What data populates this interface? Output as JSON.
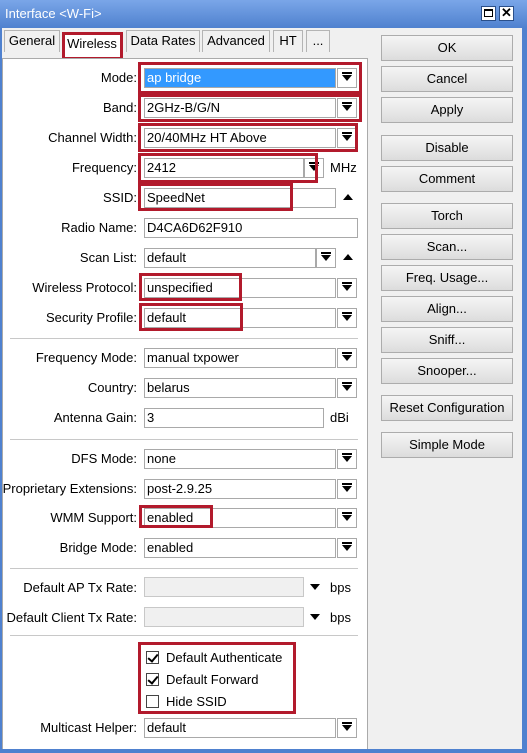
{
  "window": {
    "title": "Interface <W-Fi>",
    "close_glyph": "✕"
  },
  "tabs": [
    {
      "label": "General"
    },
    {
      "label": "Wireless"
    },
    {
      "label": "Data Rates"
    },
    {
      "label": "Advanced"
    },
    {
      "label": "HT"
    },
    {
      "label": "..."
    }
  ],
  "fields": {
    "mode": {
      "label": "Mode:",
      "value": "ap bridge"
    },
    "band": {
      "label": "Band:",
      "value": "2GHz-B/G/N"
    },
    "channel_width": {
      "label": "Channel Width:",
      "value": "20/40MHz HT Above"
    },
    "frequency": {
      "label": "Frequency:",
      "value": "2412",
      "unit": "MHz"
    },
    "ssid": {
      "label": "SSID:",
      "value": "SpeedNet"
    },
    "radio_name": {
      "label": "Radio Name:",
      "value": "D4CA6D62F910"
    },
    "scan_list": {
      "label": "Scan List:",
      "value": "default"
    },
    "wireless_protocol": {
      "label": "Wireless Protocol:",
      "value": "unspecified"
    },
    "security_profile": {
      "label": "Security Profile:",
      "value": "default"
    },
    "frequency_mode": {
      "label": "Frequency Mode:",
      "value": "manual txpower"
    },
    "country": {
      "label": "Country:",
      "value": "belarus"
    },
    "antenna_gain": {
      "label": "Antenna Gain:",
      "value": "3",
      "unit": "dBi"
    },
    "dfs_mode": {
      "label": "DFS Mode:",
      "value": "none"
    },
    "proprietary_extensions": {
      "label": "Proprietary Extensions:",
      "value": "post-2.9.25"
    },
    "wmm_support": {
      "label": "WMM Support:",
      "value": "enabled"
    },
    "bridge_mode": {
      "label": "Bridge Mode:",
      "value": "enabled"
    },
    "default_ap_tx_rate": {
      "label": "Default AP Tx Rate:",
      "value": "",
      "unit": "bps"
    },
    "default_client_tx_rate": {
      "label": "Default Client Tx Rate:",
      "value": "",
      "unit": "bps"
    },
    "multicast_helper": {
      "label": "Multicast Helper:",
      "value": "default"
    }
  },
  "checkboxes": [
    {
      "label": "Default Authenticate",
      "checked": true
    },
    {
      "label": "Default Forward",
      "checked": true
    },
    {
      "label": "Hide SSID",
      "checked": false
    }
  ],
  "buttons": [
    {
      "label": "OK"
    },
    {
      "label": "Cancel"
    },
    {
      "label": "Apply"
    },
    {
      "label": "Disable"
    },
    {
      "label": "Comment"
    },
    {
      "label": "Torch"
    },
    {
      "label": "Scan..."
    },
    {
      "label": "Freq. Usage..."
    },
    {
      "label": "Align..."
    },
    {
      "label": "Sniff..."
    },
    {
      "label": "Snooper..."
    },
    {
      "label": "Reset Configuration"
    },
    {
      "label": "Simple Mode"
    }
  ],
  "colors": {
    "titlebar": "#4f81cf",
    "highlight": "#b21a2c",
    "selection": "#3399ff"
  }
}
